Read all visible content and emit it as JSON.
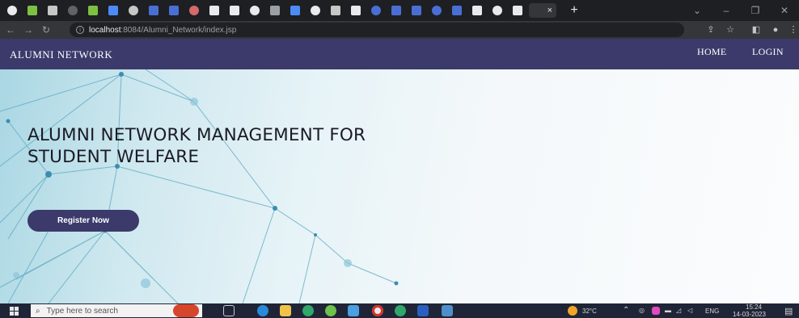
{
  "browser": {
    "tabs": [
      {
        "name": "tab-1",
        "color": "#e8eaed"
      },
      {
        "name": "tab-2",
        "color": "#7cc142"
      },
      {
        "name": "tab-3",
        "color": "#c7c7c7"
      },
      {
        "name": "tab-4",
        "color": "#5f6368"
      },
      {
        "name": "tab-5",
        "color": "#7cc142"
      },
      {
        "name": "tab-6",
        "color": "#4c8bf5"
      },
      {
        "name": "tab-7",
        "color": "#c7c7c7"
      },
      {
        "name": "tab-8",
        "color": "#4a6fd4"
      },
      {
        "name": "tab-9",
        "color": "#4a6fd4"
      },
      {
        "name": "tab-10",
        "color": "#d46a6a"
      },
      {
        "name": "tab-11",
        "color": "#e8eaed"
      },
      {
        "name": "tab-12",
        "color": "#e8eaed"
      },
      {
        "name": "tab-13",
        "color": "#e8eaed"
      },
      {
        "name": "tab-14",
        "color": "#9aa0a6"
      },
      {
        "name": "tab-15",
        "color": "#4c8bf5"
      },
      {
        "name": "tab-16",
        "color": "#e8eaed"
      },
      {
        "name": "tab-17",
        "color": "#c7c7c7"
      },
      {
        "name": "tab-18",
        "color": "#e8eaed"
      },
      {
        "name": "tab-19",
        "color": "#4a6fd4"
      },
      {
        "name": "tab-20",
        "color": "#4a6fd4"
      },
      {
        "name": "tab-21",
        "color": "#4a6fd4"
      },
      {
        "name": "tab-22",
        "color": "#4a6fd4"
      },
      {
        "name": "tab-23",
        "color": "#4a6fd4"
      },
      {
        "name": "tab-24",
        "color": "#e8eaed"
      },
      {
        "name": "tab-25",
        "color": "#e8eaed"
      },
      {
        "name": "tab-26",
        "color": "#e8eaed"
      }
    ],
    "active_tab_close": "×",
    "new_tab": "+",
    "window_controls": {
      "minimize_chevron": "⌄",
      "minimize": "–",
      "maximize": "❐",
      "close": "✕"
    },
    "url": {
      "host": "localhost",
      "path": ":8084/Alumni_Network/index.jsp"
    },
    "toolbar_icons": {
      "share": "⇪",
      "star": "☆",
      "sidepanel": "◧",
      "profile": "●",
      "menu": "⋮"
    }
  },
  "site": {
    "brand": "ALUMNI NETWORK",
    "nav": {
      "home": "HOME",
      "login": "LOGIN"
    },
    "hero": {
      "title_line1": "ALUMNI NETWORK MANAGEMENT FOR",
      "title_line2": "STUDENT WELFARE",
      "cta": "Register Now"
    },
    "colors": {
      "navbar": "#3b3a6b",
      "button": "#3b3a6b"
    }
  },
  "taskbar": {
    "search_placeholder": "Type here to search",
    "weather": "32°C",
    "language": "ENG",
    "time": "15:24",
    "date": "14-03-2023"
  }
}
